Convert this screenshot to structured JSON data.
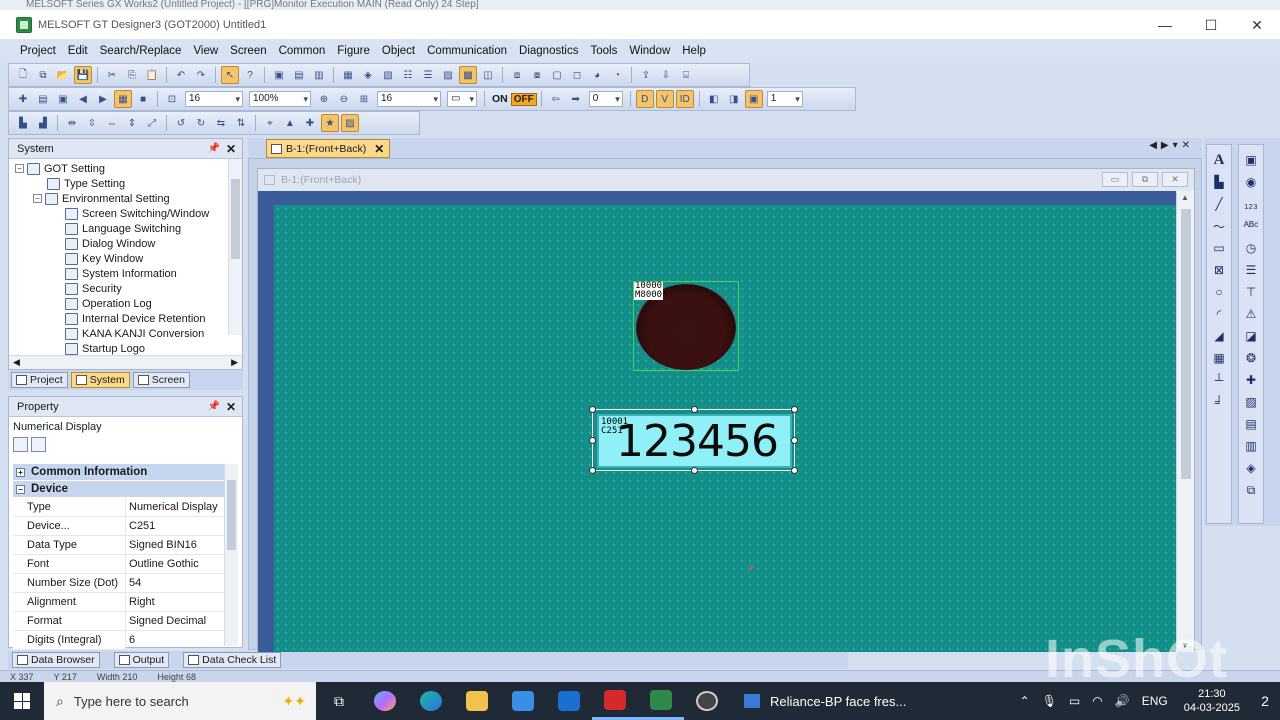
{
  "app": {
    "back_window_title": "MELSOFT Series GX Works2 (Untitled Project) - [[PRG]Monitor Execution MAIN (Read Only) 24 Step]",
    "window_title": "MELSOFT GT Designer3 (GOT2000) Untitled1"
  },
  "menu": [
    "Project",
    "Edit",
    "Search/Replace",
    "View",
    "Screen",
    "Common",
    "Figure",
    "Object",
    "Communication",
    "Diagnostics",
    "Tools",
    "Window",
    "Help"
  ],
  "toolbar2": {
    "font_size_1": "16",
    "zoom": "100%",
    "font_size_2": "16",
    "on_label": "ON",
    "off_label": "OFF",
    "state_value": "0",
    "layer_value": "1"
  },
  "system_panel": {
    "title": "System",
    "tree": [
      {
        "label": "GOT Setting",
        "level": 0,
        "expander": "−"
      },
      {
        "label": "Type Setting",
        "level": 1,
        "expander": ""
      },
      {
        "label": "Environmental Setting",
        "level": 1,
        "expander": "−"
      },
      {
        "label": "Screen Switching/Window",
        "level": 2,
        "expander": ""
      },
      {
        "label": "Language Switching",
        "level": 2,
        "expander": ""
      },
      {
        "label": "Dialog Window",
        "level": 2,
        "expander": ""
      },
      {
        "label": "Key Window",
        "level": 2,
        "expander": ""
      },
      {
        "label": "System Information",
        "level": 2,
        "expander": ""
      },
      {
        "label": "Security",
        "level": 2,
        "expander": ""
      },
      {
        "label": "Operation Log",
        "level": 2,
        "expander": ""
      },
      {
        "label": "Internal Device Retention",
        "level": 2,
        "expander": ""
      },
      {
        "label": "KANA KANJI Conversion",
        "level": 2,
        "expander": ""
      },
      {
        "label": "Startup Logo",
        "level": 2,
        "expander": ""
      }
    ]
  },
  "dock_tabs": [
    "Project",
    "System",
    "Screen"
  ],
  "property_panel": {
    "title": "Property",
    "object_type": "Numerical Display",
    "groups": [
      {
        "name": "Common Information",
        "expander": "+"
      },
      {
        "name": "Device",
        "expander": "−"
      }
    ],
    "rows": [
      {
        "key": "Type",
        "value": "Numerical Display"
      },
      {
        "key": "Device...",
        "value": "C251"
      },
      {
        "key": "Data Type",
        "value": "Signed BIN16"
      },
      {
        "key": "Font",
        "value": "Outline Gothic"
      },
      {
        "key": "Number Size (Dot)",
        "value": "54"
      },
      {
        "key": "Alignment",
        "value": "Right"
      },
      {
        "key": "Format",
        "value": "Signed Decimal"
      },
      {
        "key": "Digits (Integral)",
        "value": "6"
      }
    ]
  },
  "bottom_tabs": [
    "Data Browser",
    "Output",
    "Data Check List"
  ],
  "status": {
    "x": "X 337",
    "y": "Y 217",
    "width": "Width 210",
    "height": "Height 68"
  },
  "editor": {
    "tab_label": "B-1:(Front+Back)",
    "window_title": "B-1:(Front+Back)",
    "lamp": {
      "id": "10000",
      "device": "M8000"
    },
    "numeric": {
      "id": "10001",
      "device": "C251",
      "value": "123456"
    }
  },
  "taskbar": {
    "search_placeholder": "Type here to search",
    "news_text": "Reliance-BP face fres...",
    "language": "ENG",
    "time": "21:30",
    "date": "04-03-2025",
    "notification_count": "2"
  },
  "watermark": "InShOt",
  "colors": {
    "canvas": "#138f89",
    "canvas_frame": "#3a5c99",
    "numeric_fill": "#8ff1f7",
    "selection": "#4dd04d",
    "highlight": "#fbd88a"
  }
}
